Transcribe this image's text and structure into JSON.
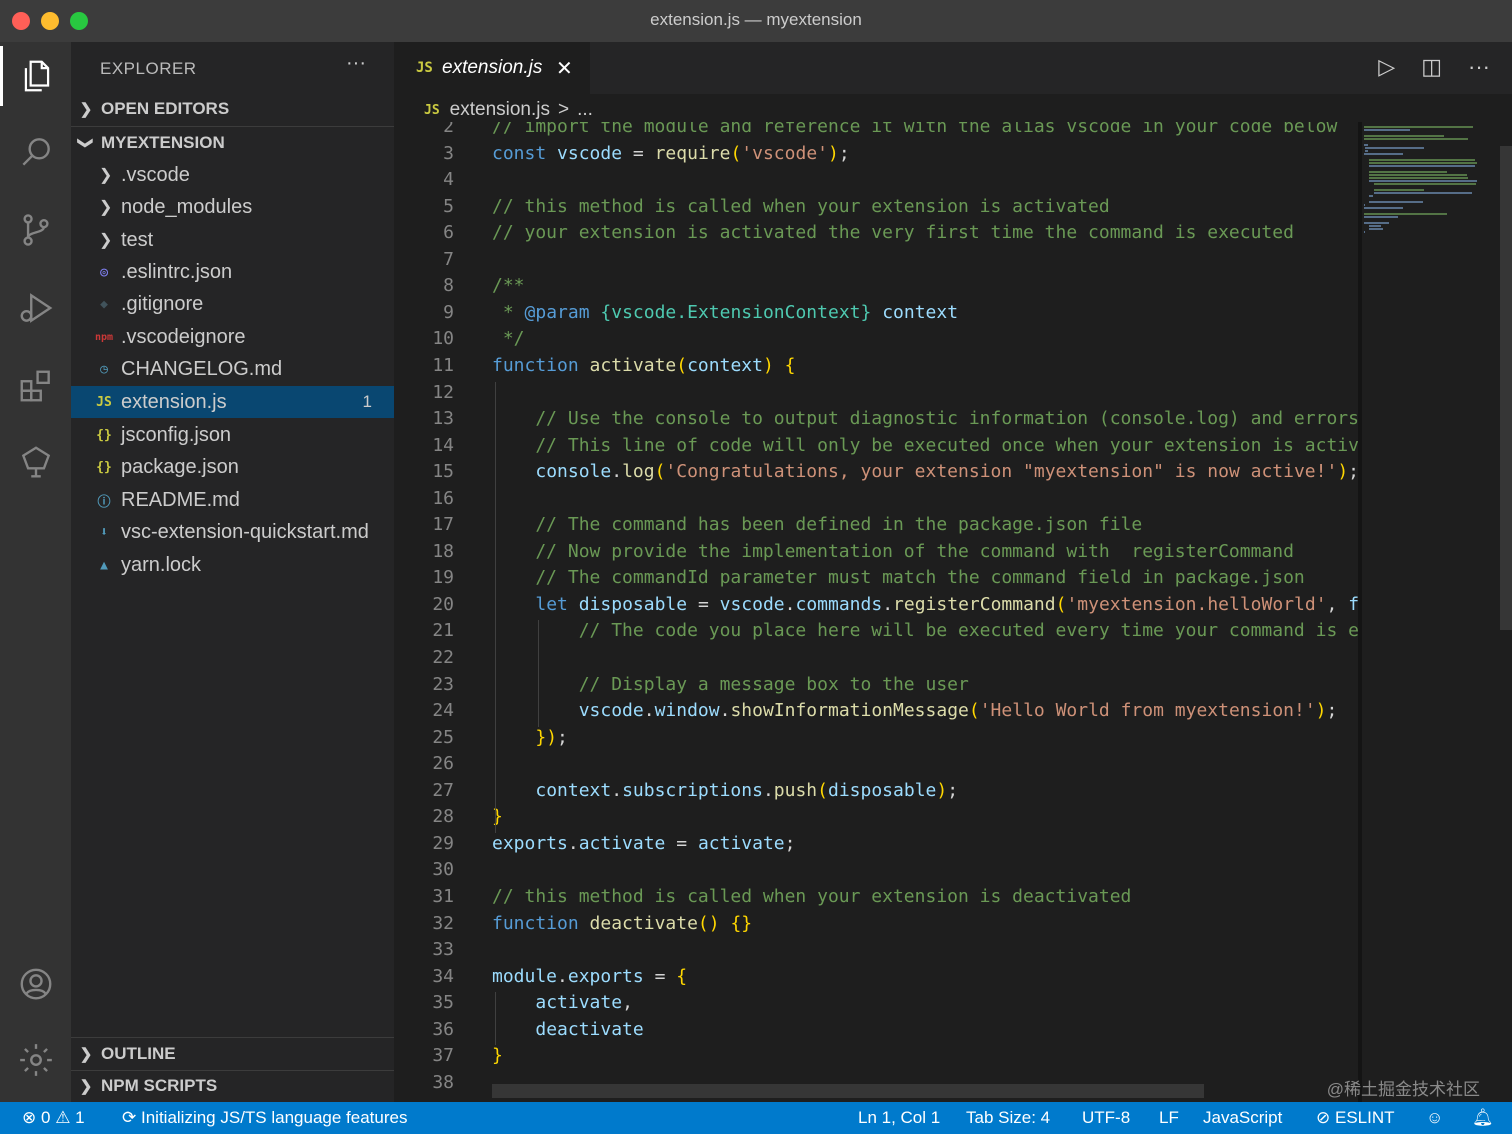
{
  "window": {
    "title": "extension.js — myextension"
  },
  "activity_bar": {
    "items": [
      {
        "icon": "files-icon"
      },
      {
        "icon": "search-icon"
      },
      {
        "icon": "source-control-icon"
      },
      {
        "icon": "run-debug-icon"
      },
      {
        "icon": "extensions-icon"
      },
      {
        "icon": "remote-explorer-icon"
      }
    ],
    "bottom": [
      {
        "icon": "account-icon"
      },
      {
        "icon": "gear-icon"
      }
    ]
  },
  "sidebar": {
    "title": "EXPLORER",
    "more": "···",
    "open_editors": "OPEN EDITORS",
    "project": "MYEXTENSION",
    "folders": [
      ".vscode",
      "node_modules",
      "test"
    ],
    "files": [
      {
        "name": ".eslintrc.json",
        "icon": "eslint-icon",
        "glyph": "◎",
        "color": "#8080f2"
      },
      {
        "name": ".gitignore",
        "icon": "git-icon",
        "glyph": "◆",
        "color": "#41535b"
      },
      {
        "name": ".vscodeignore",
        "icon": "npm-icon",
        "glyph": "npm",
        "color": "#cb3837"
      },
      {
        "name": "CHANGELOG.md",
        "icon": "changelog-icon",
        "glyph": "◷",
        "color": "#519aba"
      },
      {
        "name": "extension.js",
        "icon": "js-icon",
        "glyph": "JS",
        "color": "#cbcb41",
        "badge": "1",
        "selected": true
      },
      {
        "name": "jsconfig.json",
        "icon": "json-icon",
        "glyph": "{}",
        "color": "#cbcb41"
      },
      {
        "name": "package.json",
        "icon": "json-icon",
        "glyph": "{}",
        "color": "#cbcb41"
      },
      {
        "name": "README.md",
        "icon": "info-icon",
        "glyph": "ⓘ",
        "color": "#519aba"
      },
      {
        "name": "vsc-extension-quickstart.md",
        "icon": "markdown-icon",
        "glyph": "⬇",
        "color": "#519aba"
      },
      {
        "name": "yarn.lock",
        "icon": "yarn-icon",
        "glyph": "▲",
        "color": "#519aba"
      }
    ],
    "outline": "OUTLINE",
    "npm_scripts": "NPM SCRIPTS"
  },
  "editor": {
    "tab": {
      "label": "extension.js",
      "badge": "JS",
      "close": "✕"
    },
    "breadcrumb": {
      "badge": "JS",
      "file": "extension.js",
      "sep": ">",
      "more": "..."
    },
    "actions": [
      {
        "icon": "run-icon",
        "glyph": "▷"
      },
      {
        "icon": "split-editor-icon",
        "glyph": "◫"
      },
      {
        "icon": "more-icon",
        "glyph": "···"
      }
    ],
    "lines": [
      {
        "n": "2",
        "t": "// import the module and reference it with the alias vscode in your code below"
      },
      {
        "n": "3",
        "t": "const vscode = require('vscode');"
      },
      {
        "n": "4",
        "t": ""
      },
      {
        "n": "5",
        "t": "// this method is called when your extension is activated"
      },
      {
        "n": "6",
        "t": "// your extension is activated the very first time the command is executed"
      },
      {
        "n": "7",
        "t": ""
      },
      {
        "n": "8",
        "t": "/**"
      },
      {
        "n": "9",
        "t": " * @param {vscode.ExtensionContext} context"
      },
      {
        "n": "10",
        "t": " */"
      },
      {
        "n": "11",
        "t": "function activate(context) {"
      },
      {
        "n": "12",
        "t": ""
      },
      {
        "n": "13",
        "t": "    // Use the console to output diagnostic information (console.log) and errors"
      },
      {
        "n": "14",
        "t": "    // This line of code will only be executed once when your extension is activa"
      },
      {
        "n": "15",
        "t": "    console.log('Congratulations, your extension \"myextension\" is now active!');"
      },
      {
        "n": "16",
        "t": ""
      },
      {
        "n": "17",
        "t": "    // The command has been defined in the package.json file"
      },
      {
        "n": "18",
        "t": "    // Now provide the implementation of the command with  registerCommand"
      },
      {
        "n": "19",
        "t": "    // The commandId parameter must match the command field in package.json"
      },
      {
        "n": "20",
        "t": "    let disposable = vscode.commands.registerCommand('myextension.helloWorld', fu"
      },
      {
        "n": "21",
        "t": "        // The code you place here will be executed every time your command is ex"
      },
      {
        "n": "22",
        "t": ""
      },
      {
        "n": "23",
        "t": "        // Display a message box to the user"
      },
      {
        "n": "24",
        "t": "        vscode.window.showInformationMessage('Hello World from myextension!');"
      },
      {
        "n": "25",
        "t": "    });"
      },
      {
        "n": "26",
        "t": ""
      },
      {
        "n": "27",
        "t": "    context.subscriptions.push(disposable);"
      },
      {
        "n": "28",
        "t": "}"
      },
      {
        "n": "29",
        "t": "exports.activate = activate;"
      },
      {
        "n": "30",
        "t": ""
      },
      {
        "n": "31",
        "t": "// this method is called when your extension is deactivated"
      },
      {
        "n": "32",
        "t": "function deactivate() {}"
      },
      {
        "n": "33",
        "t": ""
      },
      {
        "n": "34",
        "t": "module.exports = {"
      },
      {
        "n": "35",
        "t": "    activate,"
      },
      {
        "n": "36",
        "t": "    deactivate"
      },
      {
        "n": "37",
        "t": "}"
      },
      {
        "n": "38",
        "t": ""
      }
    ]
  },
  "watermark": "@稀土掘金技术社区",
  "statusbar": {
    "errors": "0",
    "warnings": "1",
    "task": "Initializing JS/TS language features",
    "position": "Ln 1, Col 1",
    "tab_size": "Tab Size: 4",
    "encoding": "UTF-8",
    "eol": "LF",
    "language": "JavaScript",
    "eslint": "ESLINT"
  },
  "colors": {
    "accent": "#007acc",
    "selection": "#094771"
  }
}
